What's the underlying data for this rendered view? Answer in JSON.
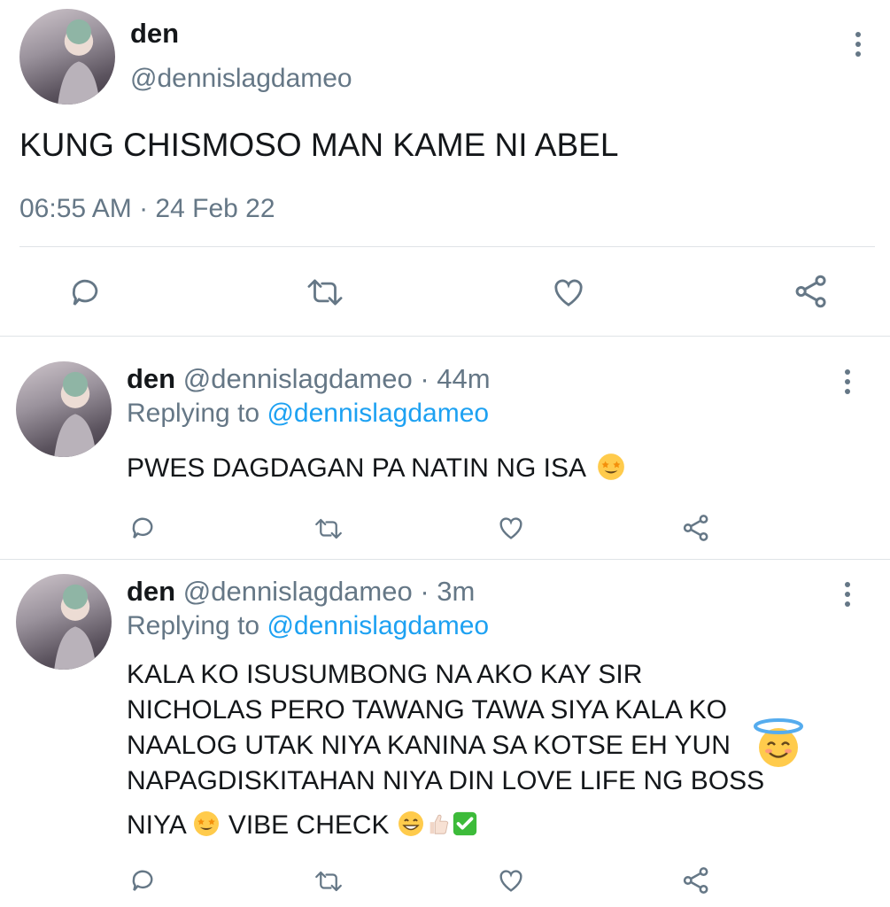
{
  "main_tweet": {
    "display_name": "den",
    "handle": "@dennislagdameo",
    "text": "KUNG CHISMOSO MAN KAME NI ABEL",
    "timestamp": "06:55 AM · 24 Feb 22"
  },
  "replies": [
    {
      "display_name": "den",
      "handle": "@dennislagdameo",
      "time": "· 44m",
      "replying_prefix": "Replying to",
      "replying_to": "@dennislagdameo",
      "text": "PWES DAGDAGAN PA NATIN NG ISA"
    },
    {
      "display_name": "den",
      "handle": "@dennislagdameo",
      "time": "· 3m",
      "replying_prefix": "Replying to",
      "replying_to": "@dennislagdameo",
      "lines": [
        "KALA KO ISUSUMBONG NA AKO KAY SIR",
        "NICHOLAS PERO TAWANG TAWA SIYA KALA KO",
        "NAALOG UTAK NIYA KANINA SA KOTSE  EH YUN",
        "NAPAGDISKITAHAN NIYA DIN LOVE LIFE NG BOSS",
        "NIYA"
      ],
      "line5_tail": "VIBE CHECK"
    }
  ],
  "icons": [
    "reply-icon",
    "retweet-icon",
    "like-icon",
    "share-icon",
    "more-icon"
  ],
  "colors": {
    "text": "#14171a",
    "secondary": "#657786",
    "link": "#1da1f2",
    "divider": "#dfe3e7"
  }
}
